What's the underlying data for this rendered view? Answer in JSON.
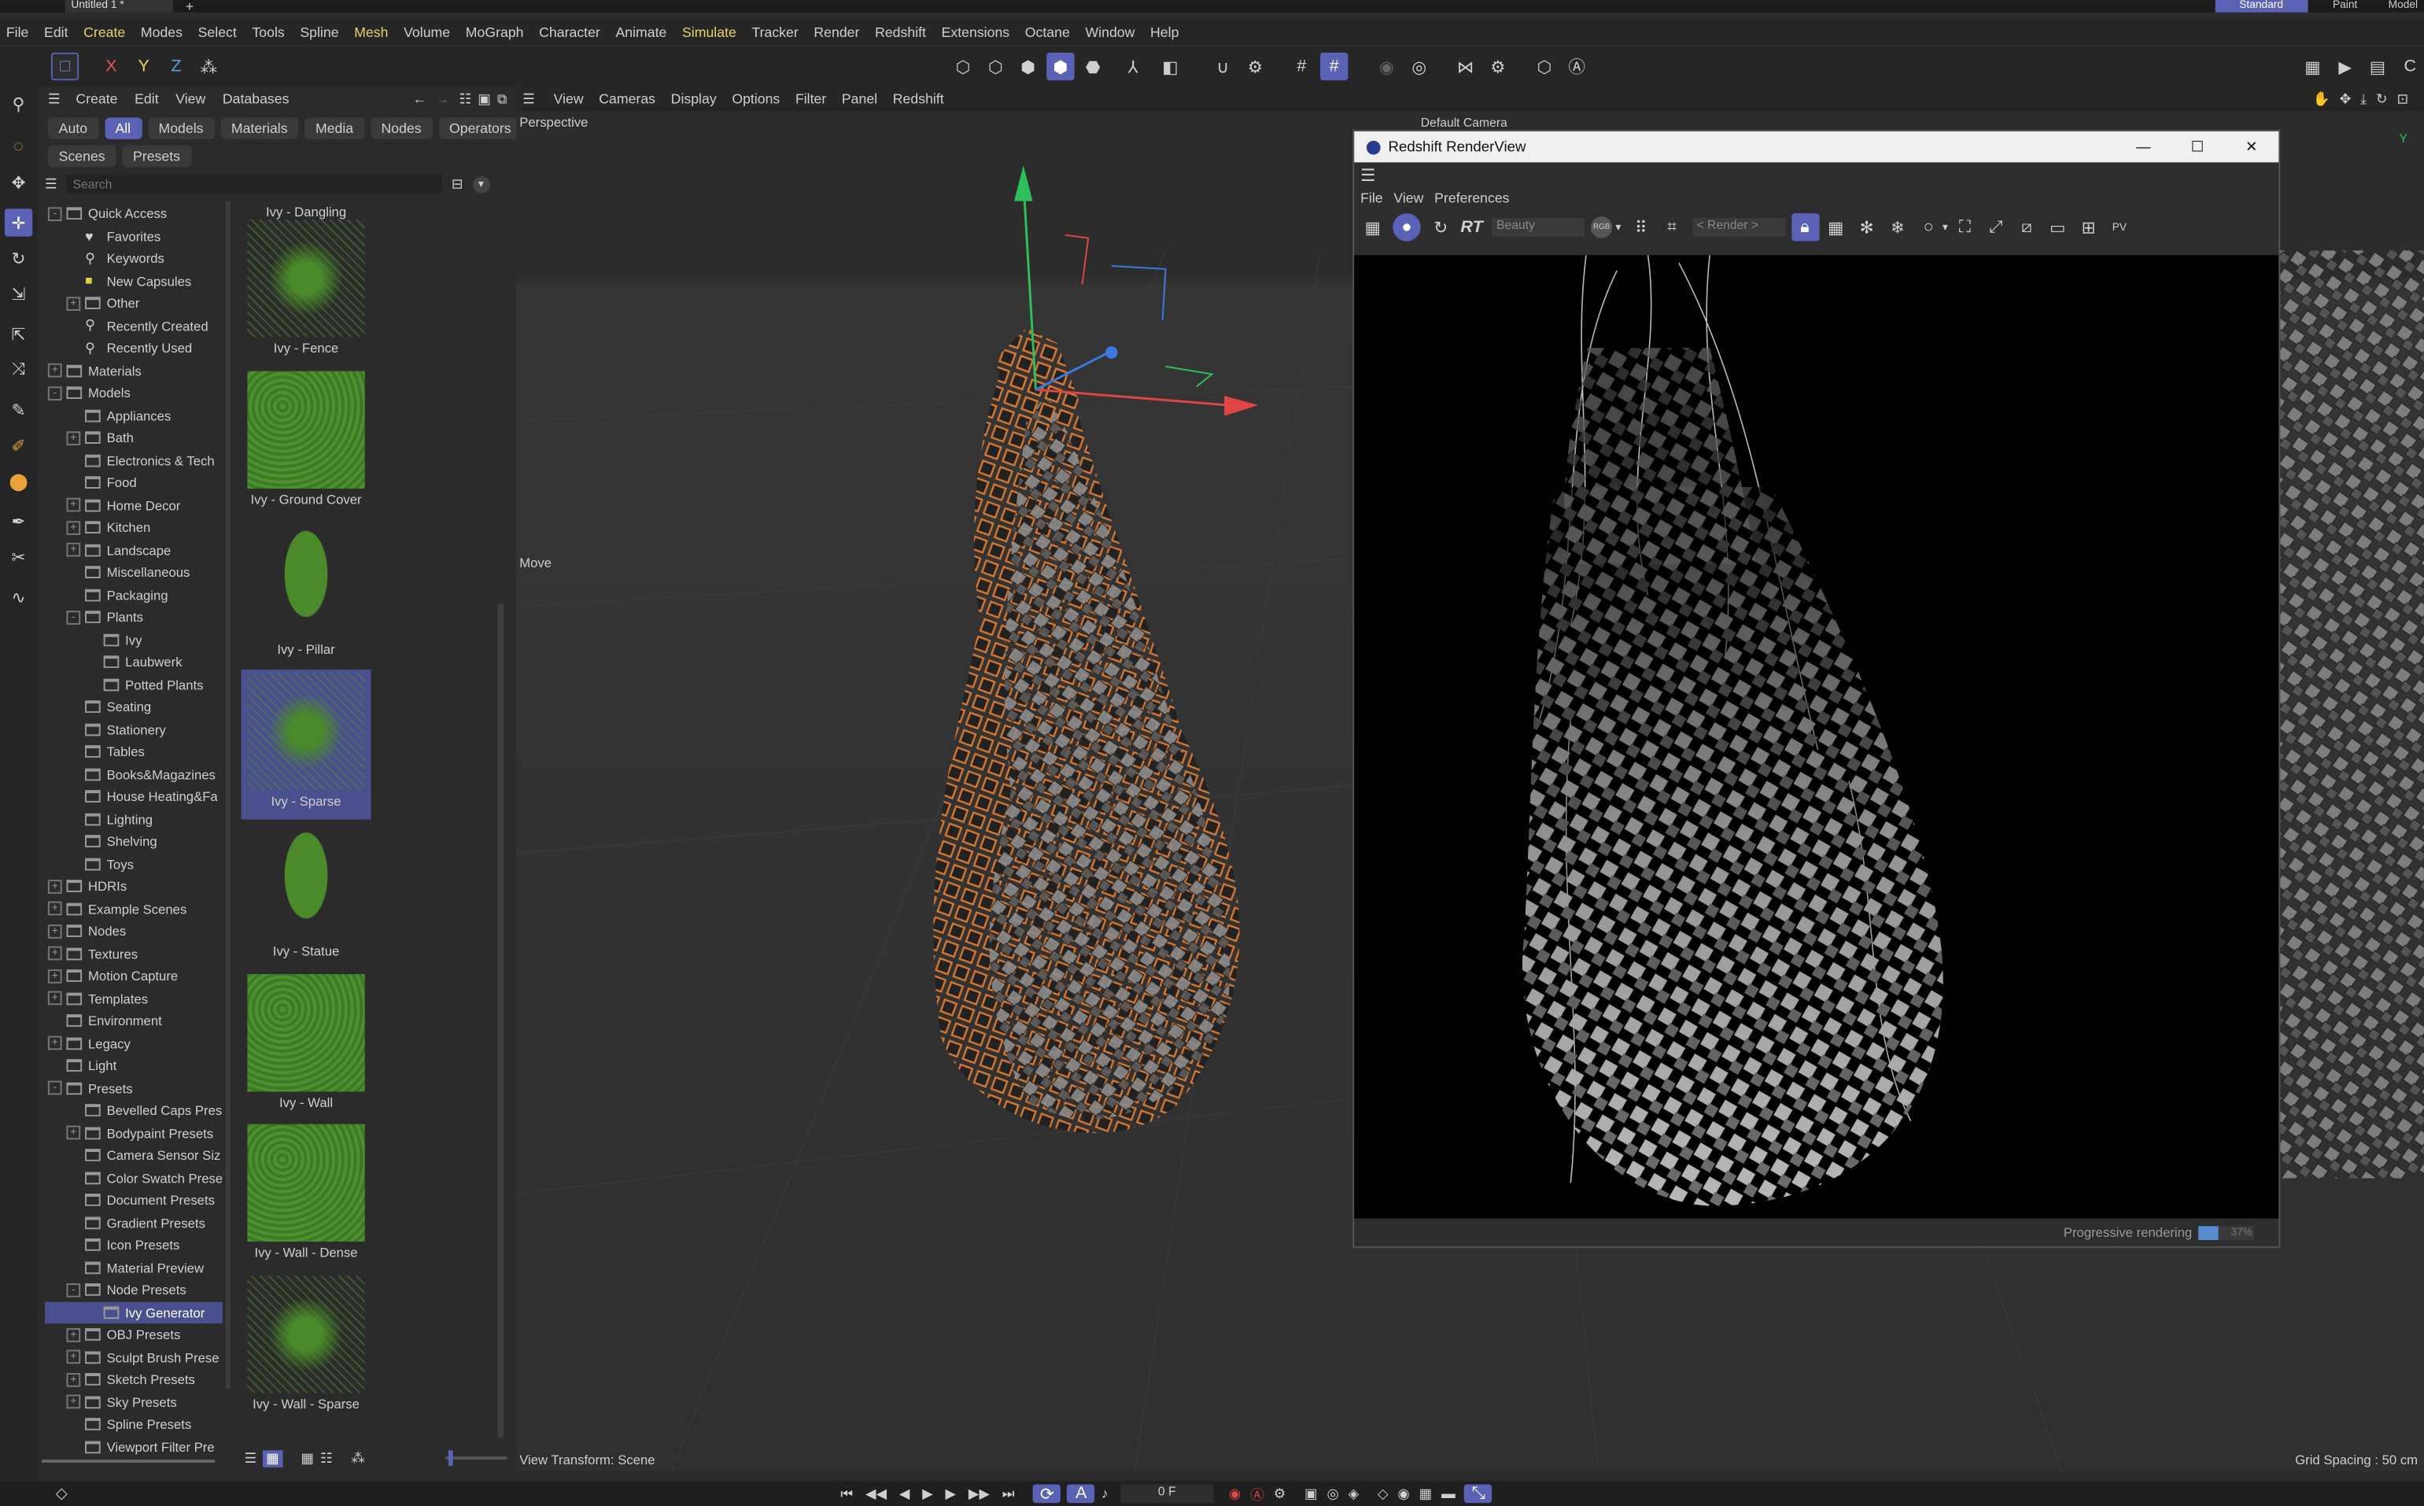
{
  "window": {
    "tab_title": "Untitled 1 *",
    "layouts": [
      "Standard",
      "Paint",
      "Model"
    ]
  },
  "menubar": [
    "File",
    "Edit",
    "Create",
    "Modes",
    "Select",
    "Tools",
    "Spline",
    "Mesh",
    "Volume",
    "MoGraph",
    "Character",
    "Animate",
    "Simulate",
    "Tracker",
    "Render",
    "Redshift",
    "Extensions",
    "Octane",
    "Window",
    "Help"
  ],
  "axes_toolbar": [
    "X",
    "Y",
    "Z"
  ],
  "asset_browser": {
    "menu": [
      "Create",
      "Edit",
      "View",
      "Databases"
    ],
    "filters": [
      "Auto",
      "All",
      "Models",
      "Materials",
      "Media",
      "Nodes",
      "Operators"
    ],
    "subtabs": [
      "Scenes",
      "Presets"
    ],
    "search_placeholder": "Search",
    "tree": [
      {
        "label": "Quick Access",
        "indent": 0,
        "exp": "-"
      },
      {
        "label": "Favorites",
        "indent": 1,
        "icon": "heart"
      },
      {
        "label": "Keywords",
        "indent": 1,
        "icon": "search"
      },
      {
        "label": "New Capsules",
        "indent": 1,
        "icon": "capsule"
      },
      {
        "label": "Other",
        "indent": 1,
        "exp": "+"
      },
      {
        "label": "Recently Created",
        "indent": 1,
        "icon": "search"
      },
      {
        "label": "Recently Used",
        "indent": 1,
        "icon": "search"
      },
      {
        "label": "Materials",
        "indent": 0,
        "exp": "+"
      },
      {
        "label": "Models",
        "indent": 0,
        "exp": "-"
      },
      {
        "label": "Appliances",
        "indent": 1
      },
      {
        "label": "Bath",
        "indent": 1,
        "exp": "+"
      },
      {
        "label": "Electronics & Tech",
        "indent": 1
      },
      {
        "label": "Food",
        "indent": 1
      },
      {
        "label": "Home Decor",
        "indent": 1,
        "exp": "+"
      },
      {
        "label": "Kitchen",
        "indent": 1,
        "exp": "+"
      },
      {
        "label": "Landscape",
        "indent": 1,
        "exp": "+"
      },
      {
        "label": "Miscellaneous",
        "indent": 1
      },
      {
        "label": "Packaging",
        "indent": 1
      },
      {
        "label": "Plants",
        "indent": 1,
        "exp": "-"
      },
      {
        "label": "Ivy",
        "indent": 2
      },
      {
        "label": "Laubwerk",
        "indent": 2
      },
      {
        "label": "Potted Plants",
        "indent": 2
      },
      {
        "label": "Seating",
        "indent": 1
      },
      {
        "label": "Stationery",
        "indent": 1
      },
      {
        "label": "Tables",
        "indent": 1
      },
      {
        "label": "Books&Magazines",
        "indent": 1
      },
      {
        "label": "House Heating&Fa",
        "indent": 1
      },
      {
        "label": "Lighting",
        "indent": 1
      },
      {
        "label": "Shelving",
        "indent": 1
      },
      {
        "label": "Toys",
        "indent": 1
      },
      {
        "label": "HDRIs",
        "indent": 0,
        "exp": "+"
      },
      {
        "label": "Example Scenes",
        "indent": 0,
        "exp": "+"
      },
      {
        "label": "Nodes",
        "indent": 0,
        "exp": "+"
      },
      {
        "label": "Textures",
        "indent": 0,
        "exp": "+"
      },
      {
        "label": "Motion Capture",
        "indent": 0,
        "exp": "+"
      },
      {
        "label": "Templates",
        "indent": 0,
        "exp": "+"
      },
      {
        "label": "Environment",
        "indent": 0
      },
      {
        "label": "Legacy",
        "indent": 0,
        "exp": "+"
      },
      {
        "label": "Light",
        "indent": 0
      },
      {
        "label": "Presets",
        "indent": 0,
        "exp": "-"
      },
      {
        "label": "Bevelled Caps Pres",
        "indent": 1
      },
      {
        "label": "Bodypaint Presets",
        "indent": 1,
        "exp": "+"
      },
      {
        "label": "Camera Sensor Siz",
        "indent": 1
      },
      {
        "label": "Color Swatch Prese",
        "indent": 1
      },
      {
        "label": "Document Presets",
        "indent": 1
      },
      {
        "label": "Gradient Presets",
        "indent": 1
      },
      {
        "label": "Icon Presets",
        "indent": 1
      },
      {
        "label": "Material Preview",
        "indent": 1
      },
      {
        "label": "Node Presets",
        "indent": 1,
        "exp": "-"
      },
      {
        "label": "Ivy Generator",
        "indent": 2,
        "selected": true
      },
      {
        "label": "OBJ Presets",
        "indent": 1,
        "exp": "+"
      },
      {
        "label": "Sculpt Brush Prese",
        "indent": 1,
        "exp": "+"
      },
      {
        "label": "Sketch Presets",
        "indent": 1,
        "exp": "+"
      },
      {
        "label": "Sky Presets",
        "indent": 1,
        "exp": "+"
      },
      {
        "label": "Spline Presets",
        "indent": 1
      },
      {
        "label": "Viewport Filter Pre",
        "indent": 1
      }
    ],
    "thumbnails": [
      {
        "label": "Ivy - Dangling",
        "kind": "cut"
      },
      {
        "label": "Ivy - Fence",
        "kind": "sparse"
      },
      {
        "label": "Ivy - Ground Cover",
        "kind": "dense"
      },
      {
        "label": "Ivy - Pillar",
        "kind": "pillar"
      },
      {
        "label": "Ivy - Sparse",
        "kind": "sparse",
        "selected": true
      },
      {
        "label": "Ivy - Statue",
        "kind": "pillar"
      },
      {
        "label": "Ivy - Wall",
        "kind": "dense"
      },
      {
        "label": "Ivy - Wall - Dense",
        "kind": "dense"
      },
      {
        "label": "Ivy - Wall - Sparse",
        "kind": "sparse"
      }
    ]
  },
  "viewport": {
    "menu": [
      "View",
      "Cameras",
      "Display",
      "Options",
      "Filter",
      "Panel",
      "Redshift"
    ],
    "view_name": "Perspective",
    "camera": "Default Camera",
    "tool_label": "Move",
    "view_transform": "View Transform: Scene",
    "grid_spacing": "Grid Spacing : 50 cm"
  },
  "renderview": {
    "title": "Redshift RenderView",
    "menu": [
      "File",
      "View",
      "Preferences"
    ],
    "aov": "Beauty",
    "render_btn": "< Render >",
    "progress_label": "Progressive rendering",
    "progress_text": "37%",
    "progress": 0.37
  },
  "timeline": {
    "frame": "0 F"
  }
}
